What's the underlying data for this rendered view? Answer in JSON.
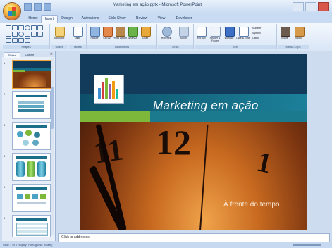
{
  "window": {
    "title": "Marketing em ação.pptx - Microsoft PowerPoint"
  },
  "ribbon": {
    "tabs": [
      "Home",
      "Insert",
      "Design",
      "Animations",
      "Slide Show",
      "Review",
      "View",
      "Developer"
    ],
    "active_tab": "Insert",
    "groups": [
      {
        "label": "Shapes"
      },
      {
        "label": "Slides"
      },
      {
        "label": "Tables"
      },
      {
        "label": "Illustrations"
      },
      {
        "label": "Links"
      },
      {
        "label": "Text"
      },
      {
        "label": "Media Clips"
      }
    ],
    "buttons": {
      "add_slide": "Add Slide",
      "table": "Table",
      "picture": "Picture",
      "clip_art": "Clip Art",
      "photo_album": "Photo Album",
      "smartart": "SmartArt",
      "chart": "Chart",
      "hyperlink": "Hyperlink",
      "action": "Action",
      "text_box": "Text Box",
      "header_footer": "Header & Footer",
      "wordart": "WordArt",
      "date_time": "Date & Time",
      "number": "Number",
      "symbol": "Symbol",
      "object": "Object",
      "movie": "Movie",
      "sound": "Sound"
    }
  },
  "slides_pane": {
    "tabs": [
      "Slides",
      "Outline"
    ],
    "active_tab": "Slides",
    "thumbnails": [
      {
        "num": "1",
        "kind": "title"
      },
      {
        "num": "2",
        "kind": "list"
      },
      {
        "num": "3",
        "kind": "circles"
      },
      {
        "num": "4",
        "kind": "cylinders"
      },
      {
        "num": "5",
        "kind": "icons"
      },
      {
        "num": "6",
        "kind": "table"
      }
    ]
  },
  "slide": {
    "title": "Marketing em ação",
    "subtitle": "À frente do tempo",
    "clock_numerals": [
      "11",
      "12",
      "1"
    ]
  },
  "notes": {
    "placeholder": "Click to add notes"
  },
  "status_bar": {
    "left": "Slide 1 of 6   \"Equity\"   Portuguese (Brazil)"
  },
  "colors": {
    "ribbon_bg": "#dbe7f6",
    "slide_title_band": "#176e87",
    "accent_green": "#7db83a"
  }
}
